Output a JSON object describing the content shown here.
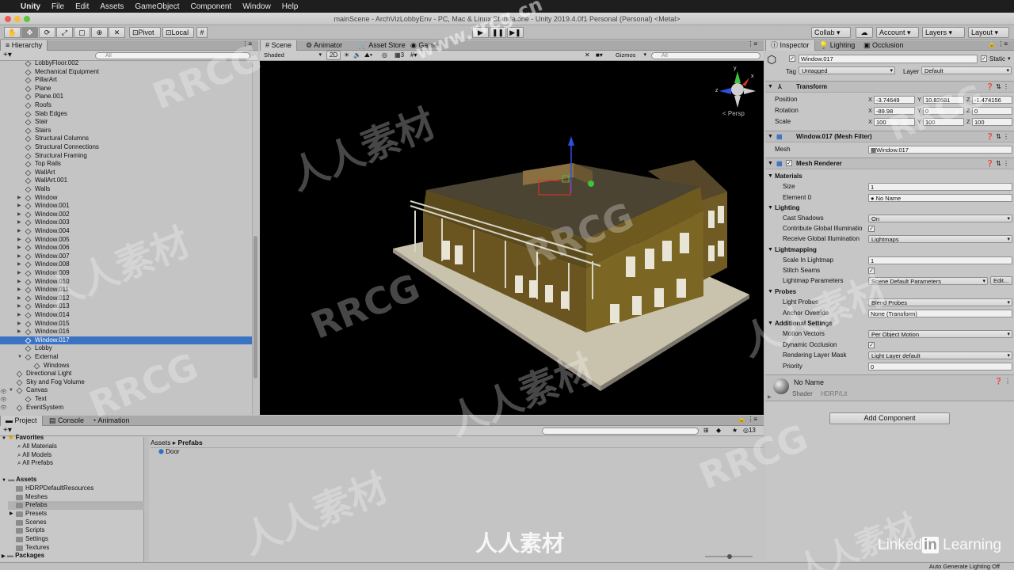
{
  "menubar": {
    "app_name": "Unity",
    "items": [
      "File",
      "Edit",
      "Assets",
      "GameObject",
      "Component",
      "Window",
      "Help"
    ]
  },
  "window_title": "mainScene - ArchVizLobbyEnv - PC, Mac & Linux Standalone - Unity 2019.4.0f1 Personal (Personal) <Metal>",
  "toolbar": {
    "pivot": "Pivot",
    "local": "Local",
    "collab": "Collab ▾",
    "account": "Account",
    "layers": "Layers",
    "layout": "Layout"
  },
  "hierarchy": {
    "tab": "Hierarchy",
    "search_placeholder": "All",
    "rows": [
      {
        "label": "LobbyFloor.002",
        "depth": 2,
        "arrow": false
      },
      {
        "label": "Mechanical Equipment",
        "depth": 2,
        "arrow": false
      },
      {
        "label": "PillarArt",
        "depth": 2,
        "arrow": false
      },
      {
        "label": "Plane",
        "depth": 2,
        "arrow": false
      },
      {
        "label": "Plane.001",
        "depth": 2,
        "arrow": false
      },
      {
        "label": "Roofs",
        "depth": 2,
        "arrow": false
      },
      {
        "label": "Slab Edges",
        "depth": 2,
        "arrow": false
      },
      {
        "label": "Stair",
        "depth": 2,
        "arrow": false
      },
      {
        "label": "Stairs",
        "depth": 2,
        "arrow": false
      },
      {
        "label": "Structural Columns",
        "depth": 2,
        "arrow": false
      },
      {
        "label": "Structural Connections",
        "depth": 2,
        "arrow": false
      },
      {
        "label": "Structural Framing",
        "depth": 2,
        "arrow": false
      },
      {
        "label": "Top Rails",
        "depth": 2,
        "arrow": false
      },
      {
        "label": "WallArt",
        "depth": 2,
        "arrow": false
      },
      {
        "label": "WallArt.001",
        "depth": 2,
        "arrow": false
      },
      {
        "label": "Walls",
        "depth": 2,
        "arrow": false
      },
      {
        "label": "Window",
        "depth": 2,
        "arrow": true
      },
      {
        "label": "Window.001",
        "depth": 2,
        "arrow": true
      },
      {
        "label": "Window.002",
        "depth": 2,
        "arrow": true
      },
      {
        "label": "Window.003",
        "depth": 2,
        "arrow": true
      },
      {
        "label": "Window.004",
        "depth": 2,
        "arrow": true
      },
      {
        "label": "Window.005",
        "depth": 2,
        "arrow": true
      },
      {
        "label": "Window.006",
        "depth": 2,
        "arrow": true
      },
      {
        "label": "Window.007",
        "depth": 2,
        "arrow": true
      },
      {
        "label": "Window.008",
        "depth": 2,
        "arrow": true
      },
      {
        "label": "Window.009",
        "depth": 2,
        "arrow": true
      },
      {
        "label": "Window.010",
        "depth": 2,
        "arrow": true
      },
      {
        "label": "Window.011",
        "depth": 2,
        "arrow": true
      },
      {
        "label": "Window.012",
        "depth": 2,
        "arrow": true
      },
      {
        "label": "Window.013",
        "depth": 2,
        "arrow": true
      },
      {
        "label": "Window.014",
        "depth": 2,
        "arrow": true
      },
      {
        "label": "Window.015",
        "depth": 2,
        "arrow": true
      },
      {
        "label": "Window.016",
        "depth": 2,
        "arrow": true
      },
      {
        "label": "Window.017",
        "depth": 2,
        "arrow": false,
        "selected": true
      },
      {
        "label": "Lobby",
        "depth": 2,
        "arrow": false
      },
      {
        "label": "External",
        "depth": 2,
        "arrow": true,
        "open": true
      },
      {
        "label": "Windows",
        "depth": 3,
        "arrow": false
      },
      {
        "label": "Directional Light",
        "depth": 1,
        "arrow": false
      },
      {
        "label": "Sky and Fog Volume",
        "depth": 1,
        "arrow": false
      },
      {
        "label": "Canvas",
        "depth": 1,
        "arrow": true,
        "open": true
      },
      {
        "label": "Text",
        "depth": 2,
        "arrow": false
      },
      {
        "label": "EventSystem",
        "depth": 1,
        "arrow": false
      }
    ]
  },
  "scene": {
    "tabs": [
      "Scene",
      "Animator",
      "Asset Store",
      "Game"
    ],
    "shading": "Shaded",
    "mode_2d": "2D",
    "layer_count": "3",
    "gizmos": "Gizmos",
    "search_placeholder": "All",
    "persp": "< Persp"
  },
  "inspector": {
    "tabs": [
      "Inspector",
      "Lighting",
      "Occlusion"
    ],
    "object_name": "Window.017",
    "static_label": "Static",
    "tag_label": "Tag",
    "tag_value": "Untagged",
    "layer_label": "Layer",
    "layer_value": "Default",
    "transform": {
      "title": "Transform",
      "position": {
        "label": "Position",
        "x": "-3.74649",
        "y": "10.82681",
        "z": "-1.474156"
      },
      "rotation": {
        "label": "Rotation",
        "x": "-89.98",
        "y": "0",
        "z": "0"
      },
      "scale": {
        "label": "Scale",
        "x": "100",
        "y": "100",
        "z": "100"
      }
    },
    "mesh_filter": {
      "title": "Window.017 (Mesh Filter)",
      "mesh_label": "Mesh",
      "mesh_value": "Window.017"
    },
    "mesh_renderer": {
      "title": "Mesh Renderer",
      "materials": "Materials",
      "size_label": "Size",
      "size_value": "1",
      "element0_label": "Element 0",
      "element0_value": "No Name",
      "lighting": "Lighting",
      "cast_shadows_label": "Cast Shadows",
      "cast_shadows_value": "On",
      "contrib_gi_label": "Contribute Global Illuminatio",
      "receive_gi_label": "Receive Global Illumination",
      "receive_gi_value": "Lightmaps",
      "lightmapping": "Lightmapping",
      "scale_lightmap_label": "Scale In Lightmap",
      "scale_lightmap_value": "1",
      "stitch_label": "Stitch Seams",
      "lm_params_label": "Lightmap Parameters",
      "lm_params_value": "Scene Default Parameters",
      "edit_label": "Edit...",
      "probes": "Probes",
      "light_probes_label": "Light Probes",
      "light_probes_value": "Blend Probes",
      "anchor_label": "Anchor Override",
      "anchor_value": "None (Transform)",
      "additional": "Additional Settings",
      "motion_label": "Motion Vectors",
      "motion_value": "Per Object Motion",
      "dyn_occ_label": "Dynamic Occlusion",
      "render_layer_label": "Rendering Layer Mask",
      "render_layer_value": "Light Layer default",
      "priority_label": "Priority",
      "priority_value": "0"
    },
    "material": {
      "name": "No Name",
      "shader_label": "Shader",
      "shader_value": "HDRP/Lit"
    },
    "add_component": "Add Component"
  },
  "project": {
    "tabs": [
      "Project",
      "Console",
      "Animation"
    ],
    "favorites": "Favorites",
    "fav_items": [
      "All Materials",
      "All Models",
      "All Prefabs"
    ],
    "assets": "Assets",
    "asset_folders": [
      "HDRPDefaultResources",
      "Meshes",
      "Prefabs",
      "Presets",
      "Scenes",
      "Scripts",
      "Settings",
      "Textures"
    ],
    "packages": "Packages",
    "breadcrumb_root": "Assets",
    "breadcrumb_sep": "▸",
    "breadcrumb_current": "Prefabs",
    "files": [
      "Door"
    ],
    "hidden_count": "13"
  },
  "status": {
    "text": "Auto Generate Lighting Off"
  },
  "watermarks": {
    "rrcg": "RRCG",
    "cn": "人人素材",
    "site": "www.rrcg.cn",
    "linkedin_1": "Linked",
    "linkedin_in": "in",
    "linkedin_2": " Learning",
    "footer_cn": "人人素材"
  }
}
